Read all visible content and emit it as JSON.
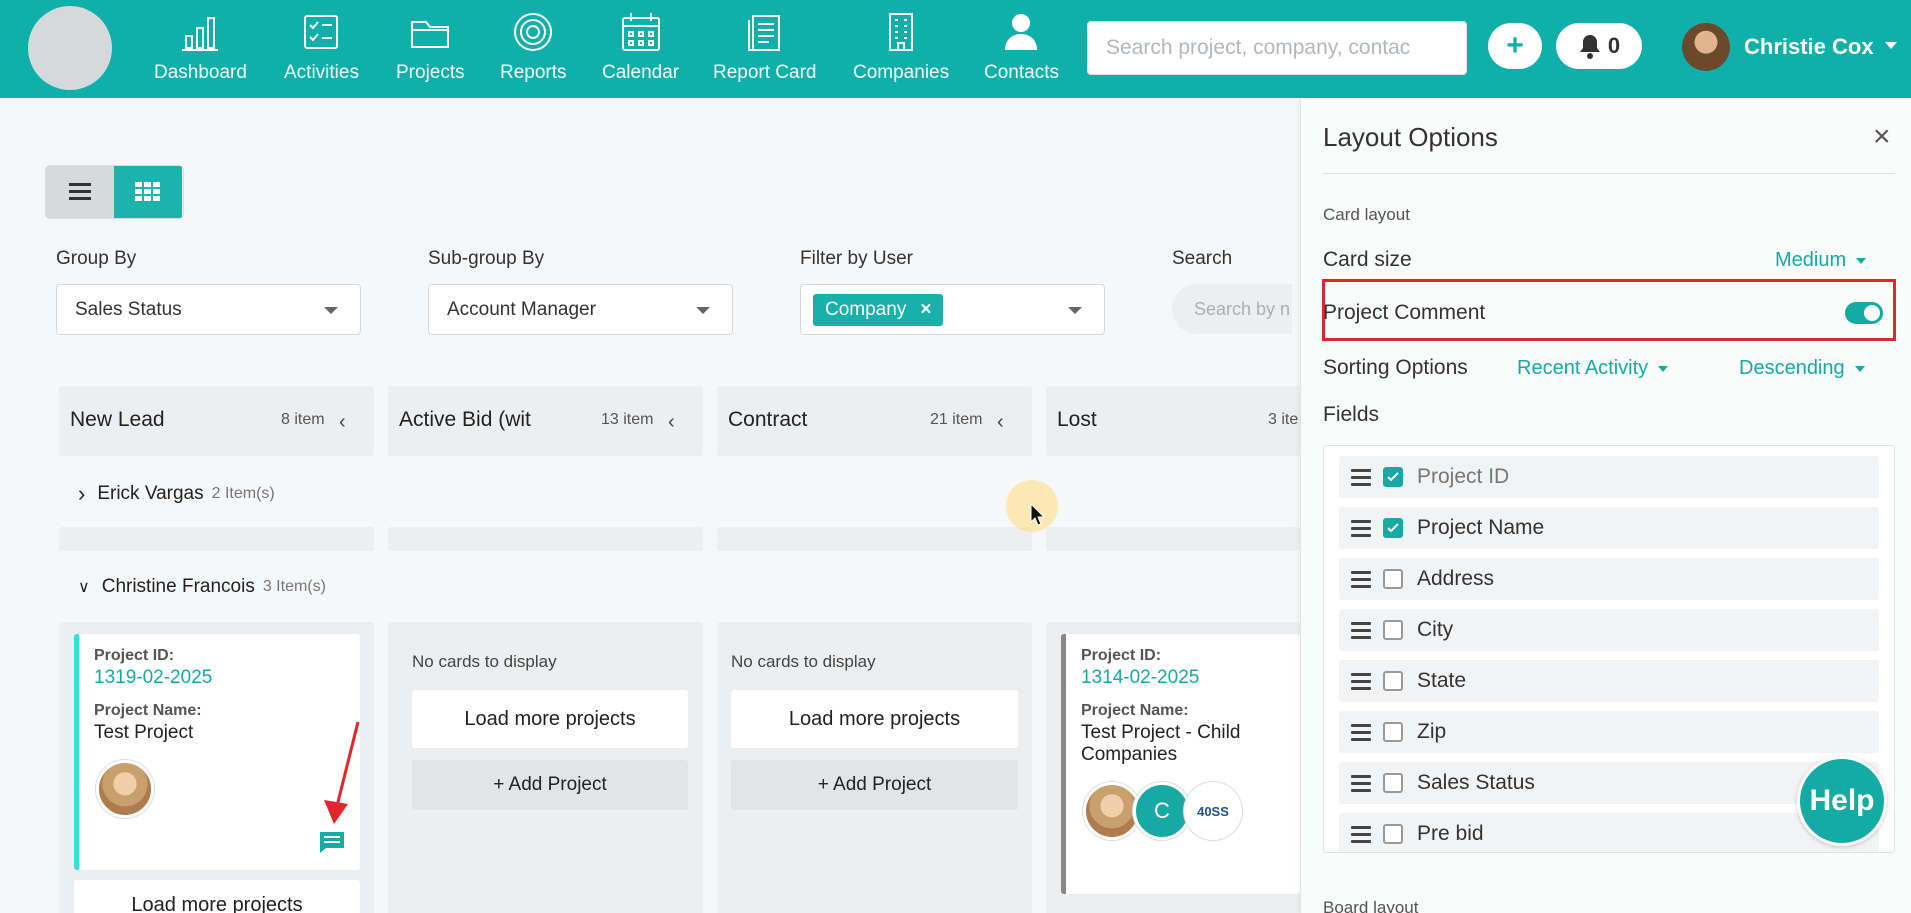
{
  "nav": {
    "items": [
      {
        "label": "Dashboard",
        "icon": "chart-bars-icon"
      },
      {
        "label": "Activities",
        "icon": "checklist-icon"
      },
      {
        "label": "Projects",
        "icon": "folder-icon"
      },
      {
        "label": "Reports",
        "icon": "target-icon"
      },
      {
        "label": "Calendar",
        "icon": "calendar-icon"
      },
      {
        "label": "Report Card",
        "icon": "clipboard-icon"
      },
      {
        "label": "Companies",
        "icon": "building-icon"
      },
      {
        "label": "Contacts",
        "icon": "person-icon"
      }
    ],
    "search_placeholder": "Search project, company, contac",
    "plus_label": "+",
    "notifications_count": "0",
    "user_name": "Christie Cox"
  },
  "filters": {
    "group_by_label": "Group By",
    "group_by_value": "Sales Status",
    "subgroup_label": "Sub-group By",
    "subgroup_value": "Account Manager",
    "filter_user_label": "Filter by User",
    "filter_user_chip": "Company",
    "filter_user_chip_remove": "×",
    "search_label": "Search",
    "search_placeholder": "Search by n"
  },
  "columns": [
    {
      "title": "New Lead",
      "count": "8 item"
    },
    {
      "title": "Active Bid (wit",
      "count": "13 item"
    },
    {
      "title": "Contract",
      "count": "21 item"
    },
    {
      "title": "Lost",
      "count": "3 ite"
    }
  ],
  "groups": [
    {
      "name": "Erick Vargas",
      "count": "2 Item(s)"
    },
    {
      "name": "Christine Francois",
      "count": "3 Item(s)"
    }
  ],
  "cards": {
    "card1": {
      "id_label": "Project ID:",
      "id": "1319-02-2025",
      "name_label": "Project Name:",
      "name": "Test Project"
    },
    "card2": {
      "id_label": "Project ID:",
      "id": "1314-02-2025",
      "name_label": "Project Name:",
      "name_line1": "Test Project - Child",
      "name_line2": "Companies",
      "avatar_letter": "C",
      "logo_text": "40SS"
    }
  },
  "column_empty": {
    "no_cards": "No cards to display",
    "load_more": "Load more projects",
    "add_project": "+ Add Project"
  },
  "panel": {
    "title": "Layout Options",
    "close": "×",
    "card_layout_label": "Card layout",
    "card_size_label": "Card size",
    "card_size_value": "Medium",
    "project_comment_label": "Project Comment",
    "sorting_label": "Sorting Options",
    "sort_by": "Recent Activity",
    "sort_dir": "Descending",
    "fields_label": "Fields",
    "fields": [
      {
        "name": "Project ID",
        "checked": true
      },
      {
        "name": "Project Name",
        "checked": true
      },
      {
        "name": "Address",
        "checked": false
      },
      {
        "name": "City",
        "checked": false
      },
      {
        "name": "State",
        "checked": false
      },
      {
        "name": "Zip",
        "checked": false
      },
      {
        "name": "Sales Status",
        "checked": false
      },
      {
        "name": "Pre bid",
        "checked": false
      }
    ],
    "board_layout_label": "Board layout"
  },
  "help_label": "Help",
  "colors": {
    "brand": "#0fb0aa",
    "highlight": "#e3262a"
  }
}
